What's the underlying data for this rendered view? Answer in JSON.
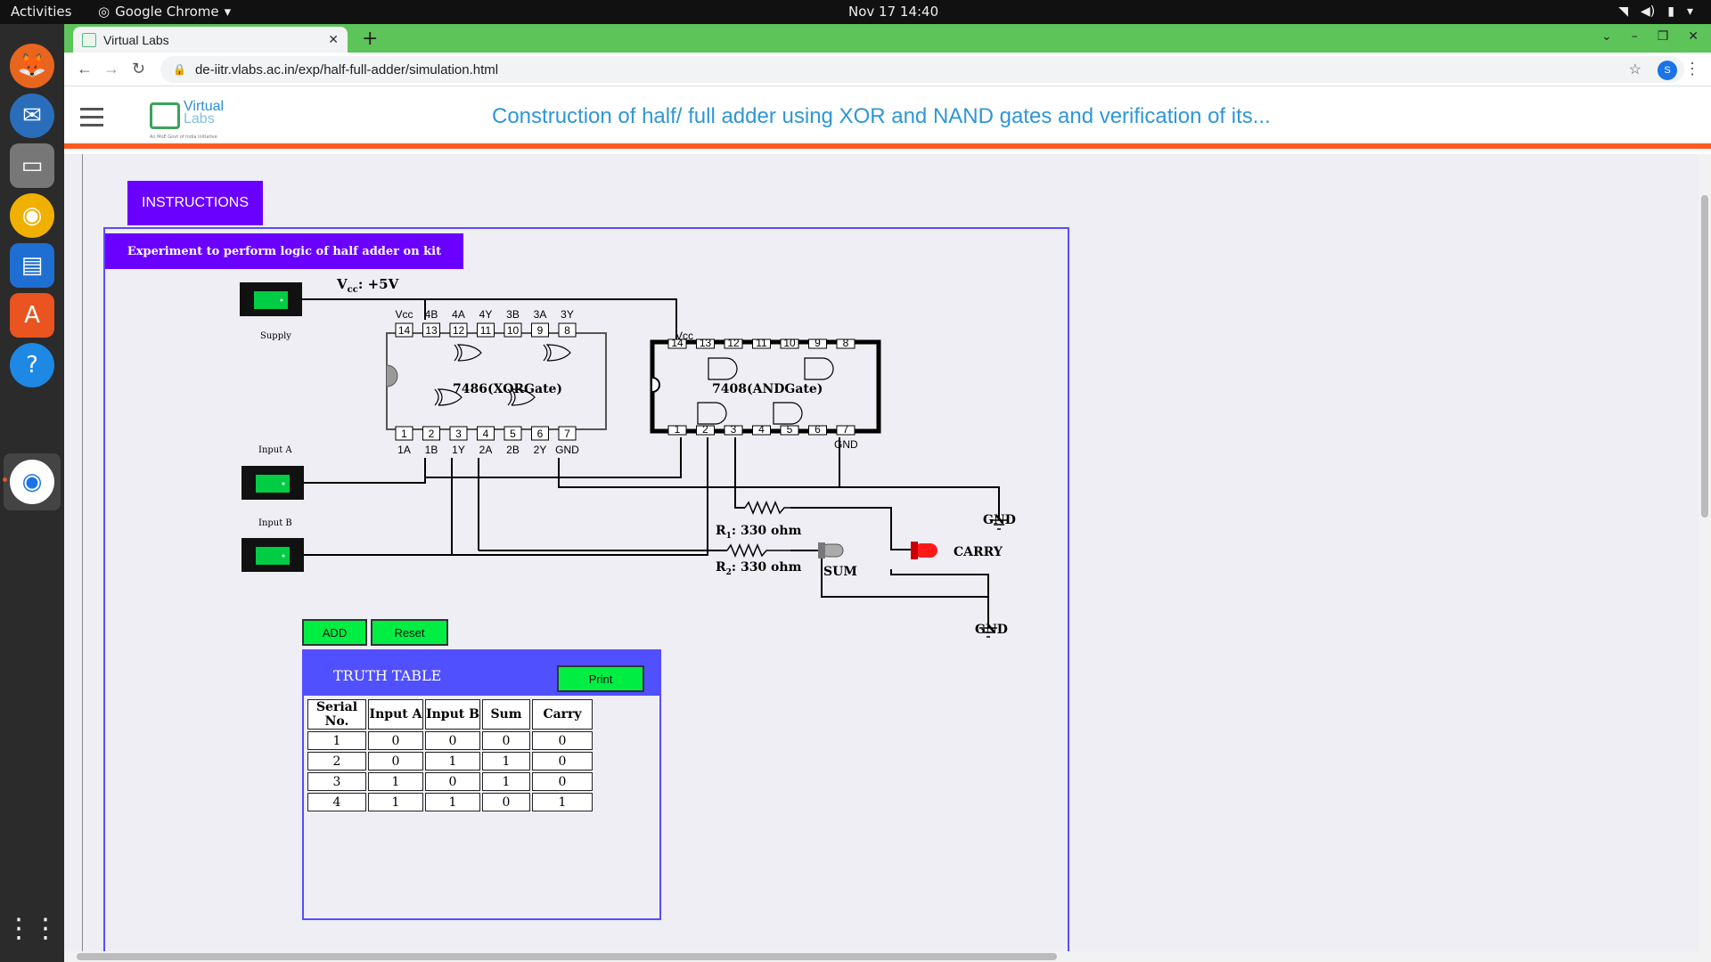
{
  "topbar": {
    "activities": "Activities",
    "app_name": "Google Chrome",
    "clock": "Nov 17  14:40"
  },
  "browser": {
    "tab_title": "Virtual Labs",
    "url": "de-iitr.vlabs.ac.in/exp/half-full-adder/simulation.html",
    "profile_initial": "S"
  },
  "site": {
    "logo_line1": "Virtual",
    "logo_line2": "Labs",
    "logo_tagline": "An MoE Govt of India Initiative",
    "title": "Construction of half/ full adder using XOR and NAND gates and verification of its..."
  },
  "instructions_label": "INSTRUCTIONS",
  "experiment_title": "Experiment to perform logic of half adder on kit",
  "circuit": {
    "vcc_label": "V",
    "vcc_sub": "cc",
    "vcc_value": ": +5V",
    "supply_label": "Supply",
    "input_a_label": "Input A",
    "input_b_label": "Input B",
    "xor_ic_label": "7486(XORGate)",
    "and_ic_label": "7408(ANDGate)",
    "xor_top_pins": [
      "Vcc",
      "4B",
      "4A",
      "4Y",
      "3B",
      "3A",
      "3Y"
    ],
    "xor_top_nums": [
      "14",
      "13",
      "12",
      "11",
      "10",
      "9",
      "8"
    ],
    "xor_bottom_nums": [
      "1",
      "2",
      "3",
      "4",
      "5",
      "6",
      "7"
    ],
    "xor_bottom_pins": [
      "1A",
      "1B",
      "1Y",
      "2A",
      "2B",
      "2Y",
      "GND"
    ],
    "and_vcc": "Vcc",
    "and_gnd": "GND",
    "r1_label": "R",
    "r1_sub": "1",
    "r1_value": ": 330 ohm",
    "r2_label": "R",
    "r2_sub": "2",
    "r2_value": ": 330 ohm",
    "sum_label": "SUM",
    "carry_label": "CARRY",
    "gnd_label_1": "GND",
    "gnd_label_2": "GND"
  },
  "buttons": {
    "add": "ADD",
    "reset": "Reset",
    "print": "Print"
  },
  "truth_table": {
    "title": "TRUTH TABLE",
    "headers": [
      "Serial No.",
      "Input A",
      "Input B",
      "Sum",
      "Carry"
    ],
    "rows": [
      [
        "1",
        "0",
        "0",
        "0",
        "0"
      ],
      [
        "2",
        "0",
        "1",
        "1",
        "0"
      ],
      [
        "3",
        "1",
        "0",
        "1",
        "0"
      ],
      [
        "4",
        "1",
        "1",
        "0",
        "1"
      ]
    ]
  },
  "colors": {
    "accent_purple": "#6a00ff",
    "switch_green": "#00cc44",
    "header_orange": "#ff5a1f",
    "title_blue": "#2f96d8",
    "led_red": "#ff1a1a"
  }
}
